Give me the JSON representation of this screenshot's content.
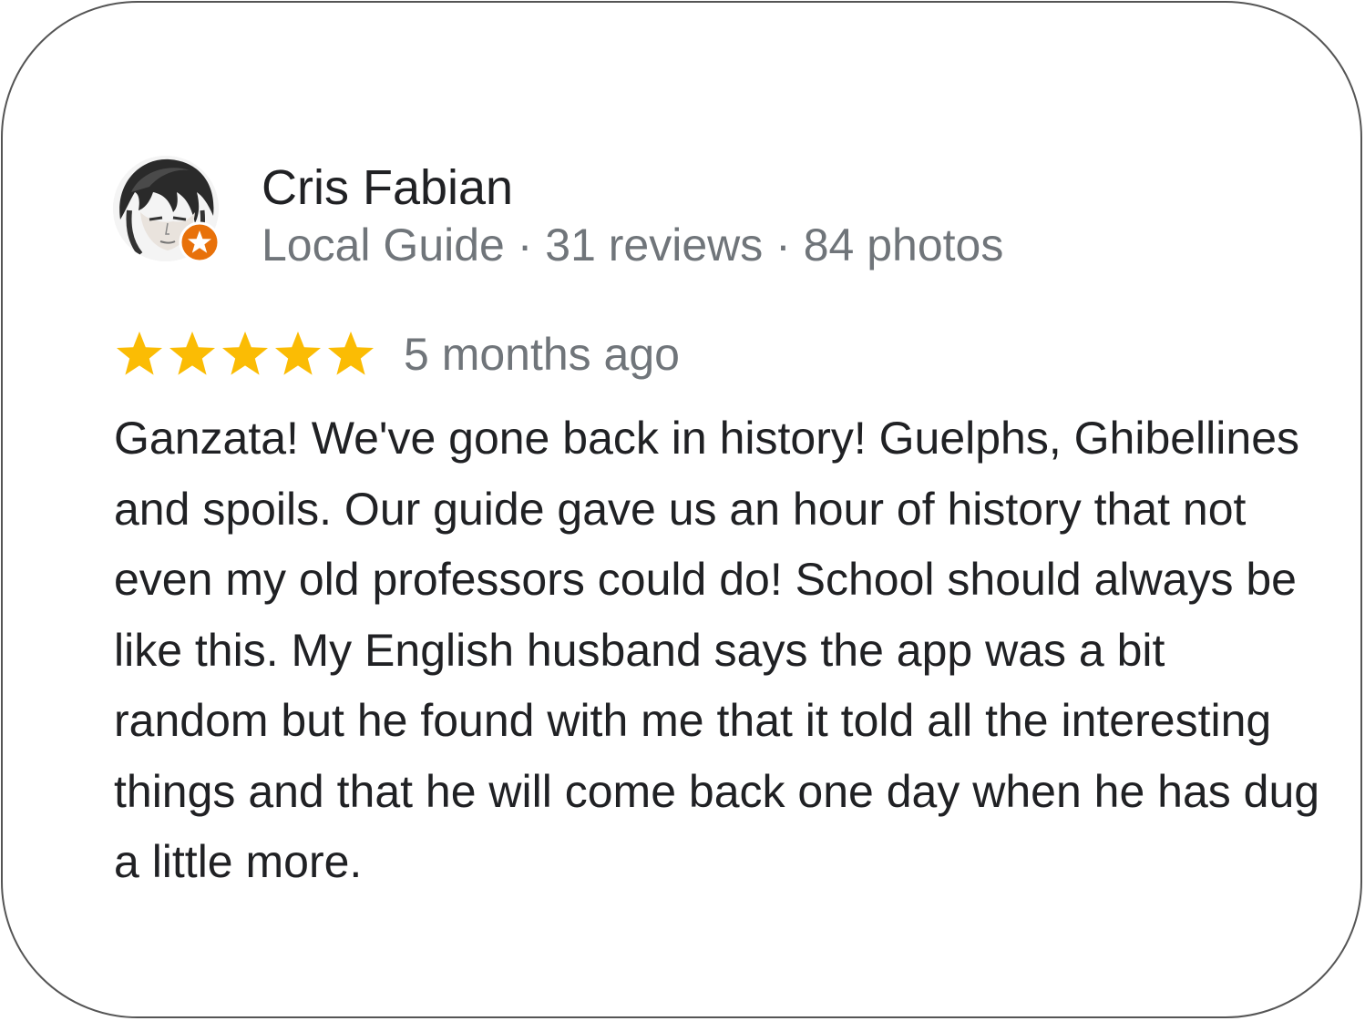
{
  "reviewer": {
    "name": "Cris Fabian",
    "meta": "Local Guide · 31 reviews · 84 photos",
    "avatar_icon": "avatar-portrait",
    "badge_icon": "local-guide-star-badge",
    "badge_color": "#e8710a"
  },
  "review": {
    "rating": 5,
    "rating_max": 5,
    "star_color": "#fbbc04",
    "date": "5 months ago",
    "text": "Ganzata! We've gone back in history! Guelphs, Ghibellines and spoils. Our guide gave us an hour of history that not even my old professors could do! School should always be like this. My English husband says the app was a bit random but he found with me that it told all the interesting things and that he will come back one day when he has dug a little more."
  }
}
